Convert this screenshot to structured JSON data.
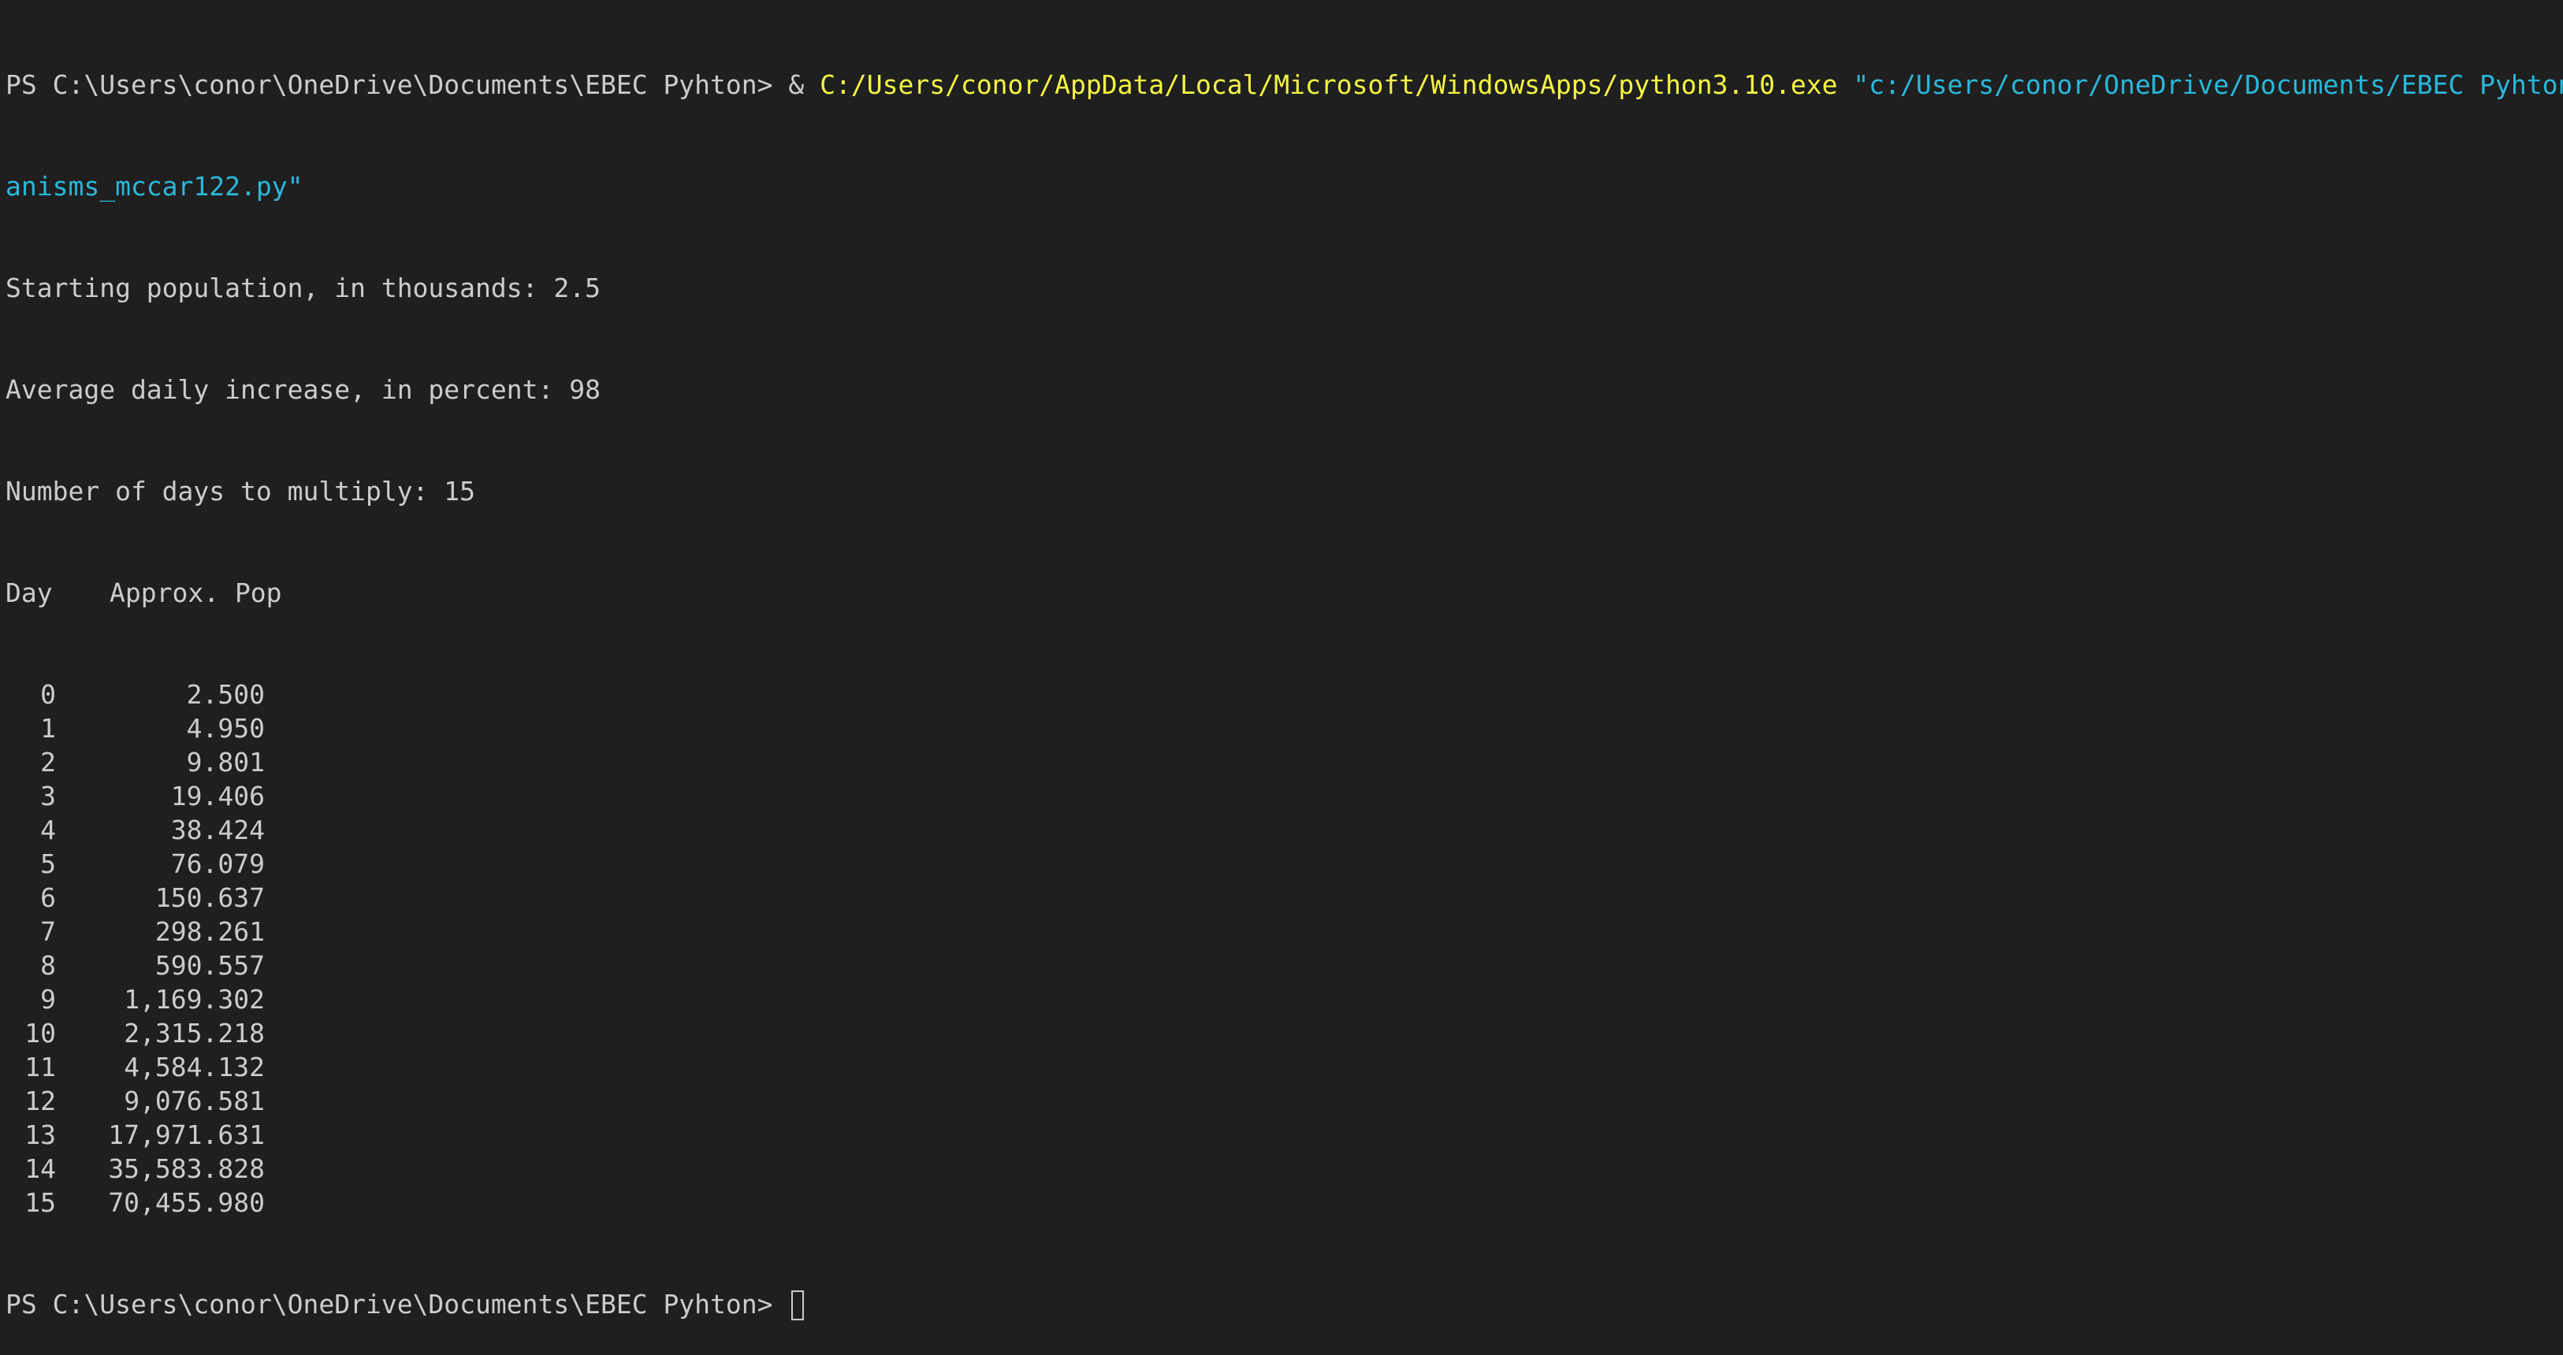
{
  "prompt": "PS C:\\Users\\conor\\OneDrive\\Documents\\EBEC Pyhton> ",
  "command": {
    "operator": "& ",
    "executable": "C:/Users/conor/AppData/Local/Microsoft/WindowsApps/python3.10.exe",
    "space": " ",
    "script_part1": "\"c:/Users/conor/OneDrive/Documents/EBEC Pyhton/org",
    "script_part2": "anisms_mccar122.py\""
  },
  "inputs": [
    "Starting population, in thousands: 2.5",
    "Average daily increase, in percent: 98",
    "Number of days to multiply: 15"
  ],
  "table": {
    "header_day": "Day",
    "header_pop": "Approx. Pop",
    "rows": [
      {
        "day": "0",
        "pop": "2.500"
      },
      {
        "day": "1",
        "pop": "4.950"
      },
      {
        "day": "2",
        "pop": "9.801"
      },
      {
        "day": "3",
        "pop": "19.406"
      },
      {
        "day": "4",
        "pop": "38.424"
      },
      {
        "day": "5",
        "pop": "76.079"
      },
      {
        "day": "6",
        "pop": "150.637"
      },
      {
        "day": "7",
        "pop": "298.261"
      },
      {
        "day": "8",
        "pop": "590.557"
      },
      {
        "day": "9",
        "pop": "1,169.302"
      },
      {
        "day": "10",
        "pop": "2,315.218"
      },
      {
        "day": "11",
        "pop": "4,584.132"
      },
      {
        "day": "12",
        "pop": "9,076.581"
      },
      {
        "day": "13",
        "pop": "17,971.631"
      },
      {
        "day": "14",
        "pop": "35,583.828"
      },
      {
        "day": "15",
        "pop": "70,455.980"
      }
    ]
  },
  "final_prompt": "PS C:\\Users\\conor\\OneDrive\\Documents\\EBEC Pyhton> ",
  "colors": {
    "background": "#1f1f1f",
    "text": "#cccccc",
    "executable": "#f5f543",
    "string": "#29b8db"
  }
}
